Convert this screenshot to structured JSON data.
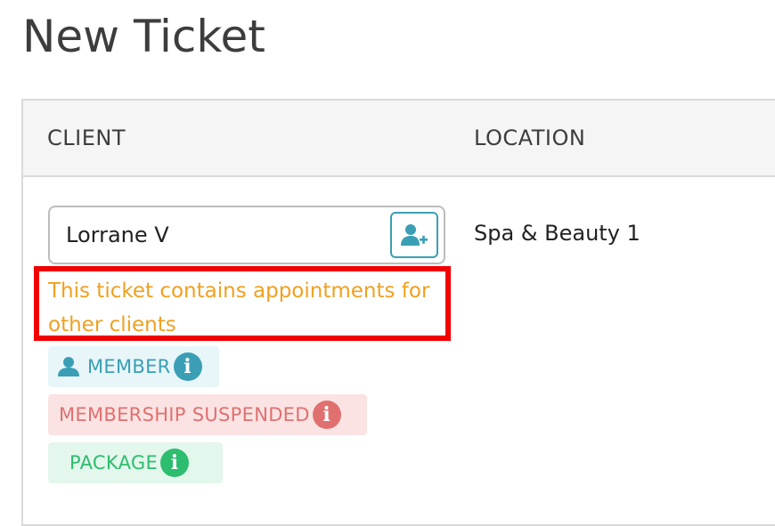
{
  "page": {
    "title": "New Ticket"
  },
  "table": {
    "columns": {
      "client": "CLIENT",
      "location": "LOCATION"
    }
  },
  "client": {
    "value": "Lorrane V",
    "add_button_icon": "add-user-icon"
  },
  "location": {
    "value": "Spa & Beauty 1"
  },
  "warning": {
    "text": "This ticket contains appointments for other clients"
  },
  "badges": {
    "member": {
      "label": "MEMBER",
      "color": "#3a9fb5",
      "icon": "user-icon"
    },
    "suspended": {
      "label": "MEMBERSHIP SUSPENDED",
      "color": "#e07070"
    },
    "package": {
      "label": "PACKAGE",
      "color": "#2dbd6e"
    }
  },
  "colors": {
    "accent": "#3a9fb5",
    "warning_text": "#f0a020",
    "highlight_border": "#f20000"
  }
}
